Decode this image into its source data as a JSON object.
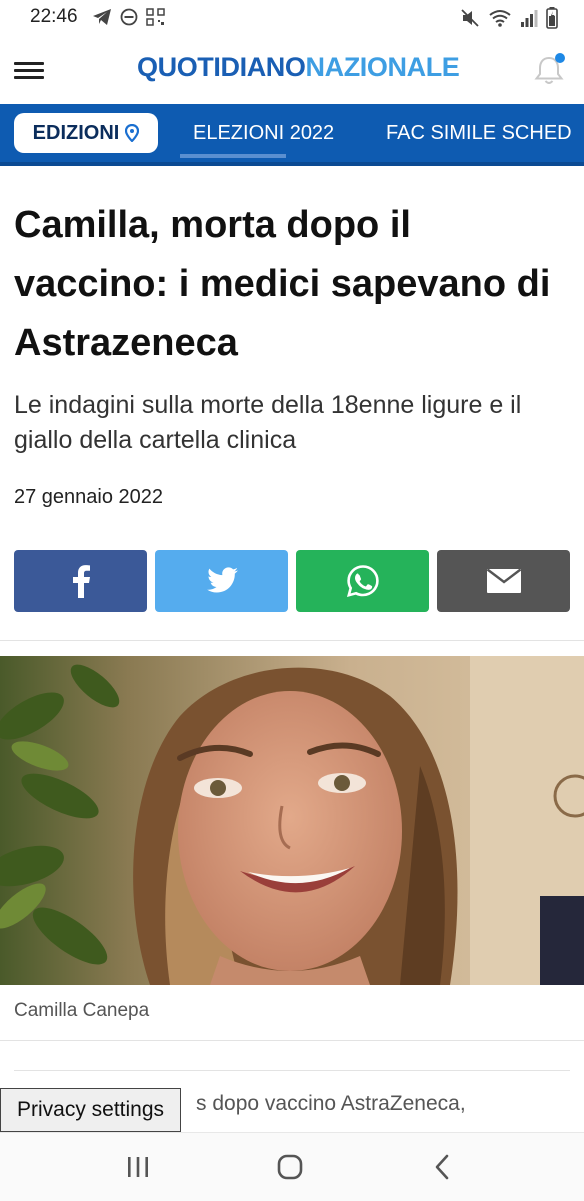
{
  "status_bar": {
    "time": "22:46"
  },
  "header": {
    "logo_part1": "QUOTIDIANO",
    "logo_part2": "NAZIONALE",
    "colors": {
      "logo_dark": "#1a5fb4",
      "logo_light": "#3e9ee3",
      "notification_dot": "#1e88e5"
    }
  },
  "nav": {
    "edizioni_label": "EDIZIONI",
    "tabs": [
      {
        "label": "ELEZIONI 2022"
      },
      {
        "label": "FAC SIMILE SCHED"
      }
    ],
    "colors": {
      "background": "#0e5bb1"
    }
  },
  "article": {
    "title": "Camilla, morta dopo il vaccino: i medici sapevano di Astrazeneca",
    "subtitle": "Le indagini sulla morte della 18enne ligure e il giallo della cartella clinica",
    "date": "27 gennaio 2022",
    "photo_caption": "Camilla Canepa",
    "teaser_text": "s dopo vaccino AstraZeneca,"
  },
  "share_buttons": [
    {
      "icon": "facebook-icon",
      "color": "#3b5998"
    },
    {
      "icon": "twitter-icon",
      "color": "#55acee"
    },
    {
      "icon": "whatsapp-icon",
      "color": "#25b35a"
    },
    {
      "icon": "email-icon",
      "color": "#555555"
    }
  ],
  "privacy_button": {
    "label": "Privacy settings"
  },
  "system_nav": {
    "icons": [
      "recent-apps-icon",
      "home-icon",
      "back-icon"
    ]
  }
}
